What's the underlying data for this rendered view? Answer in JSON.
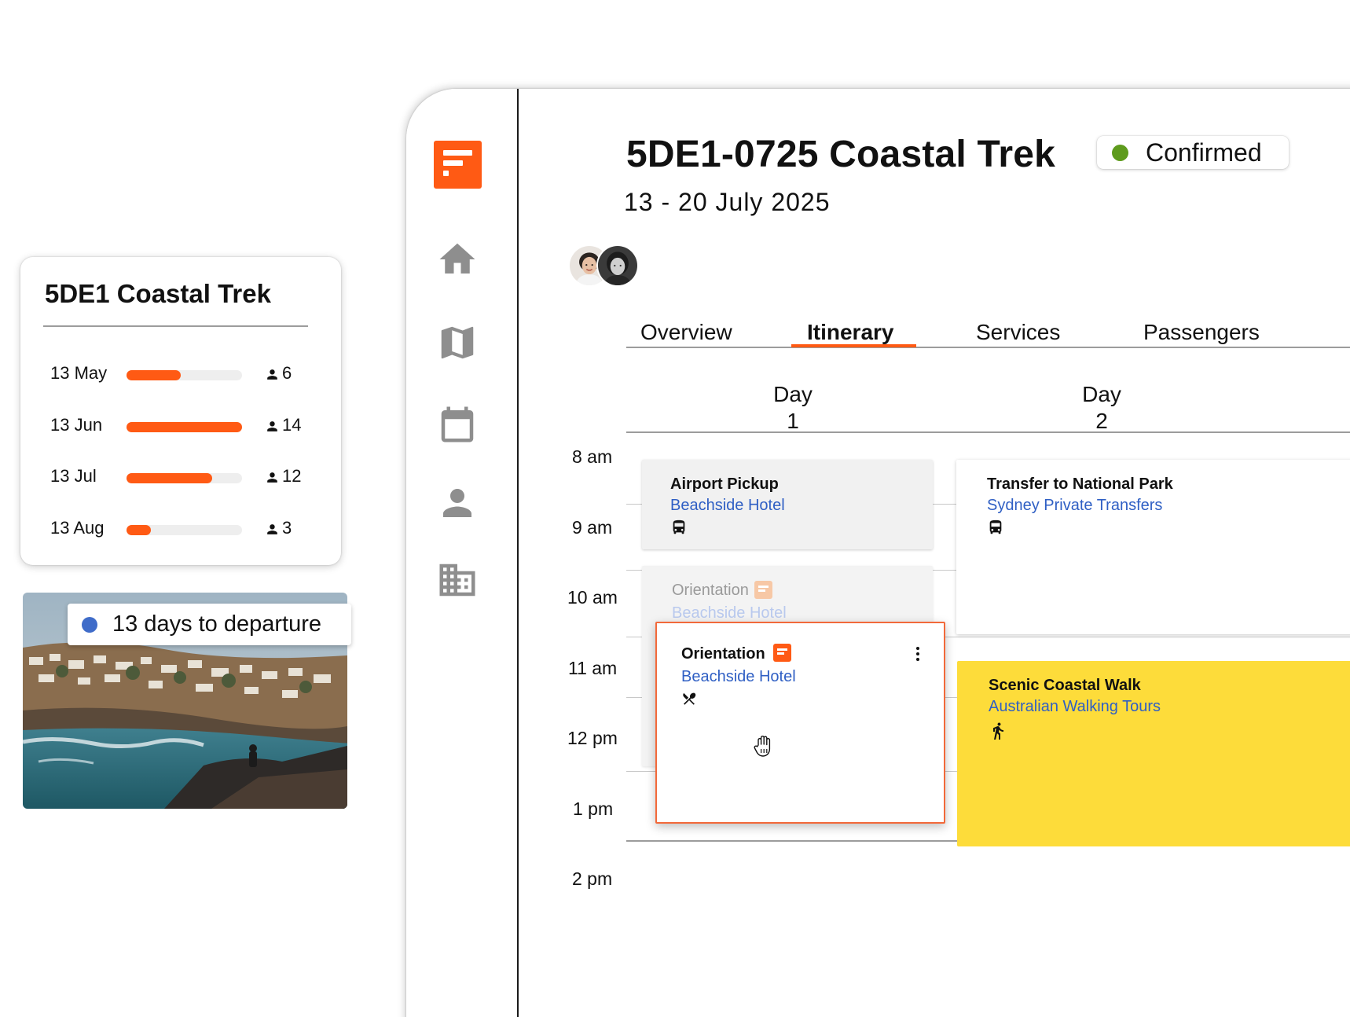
{
  "app": {
    "brand_color": "#ff5a14",
    "nav": [
      {
        "name": "home",
        "icon": "home-icon"
      },
      {
        "name": "map",
        "icon": "map-icon"
      },
      {
        "name": "calendar",
        "icon": "calendar-icon"
      },
      {
        "name": "person",
        "icon": "person-icon"
      },
      {
        "name": "building",
        "icon": "building-icon"
      }
    ]
  },
  "trip": {
    "title": "5DE1-0725 Coastal Trek",
    "status": "Confirmed",
    "status_color": "#5e9b1d",
    "dates": "13 - 20 July 2025"
  },
  "tabs": [
    {
      "label": "Overview",
      "active": false
    },
    {
      "label": "Itinerary",
      "active": true
    },
    {
      "label": "Services",
      "active": false
    },
    {
      "label": "Passengers",
      "active": false
    }
  ],
  "schedule": {
    "days": [
      {
        "label": "Day",
        "number": "1"
      },
      {
        "label": "Day",
        "number": "2"
      }
    ],
    "times": [
      "8 am",
      "9 am",
      "10 am",
      "11 am",
      "12 pm",
      "1 pm",
      "2 pm"
    ],
    "events": {
      "pickup": {
        "title": "Airport Pickup",
        "subtitle": "Beachside Hotel",
        "icon": "bus-icon"
      },
      "orientation_ghost": {
        "title": "Orientation",
        "subtitle": "Beachside Hotel",
        "icon": "note-icon"
      },
      "orientation": {
        "title": "Orientation",
        "subtitle": "Beachside Hotel",
        "icon": "note-icon",
        "icon2": "restaurant-icon"
      },
      "transfer": {
        "title": "Transfer to National Park",
        "subtitle": "Sydney Private Transfers",
        "icon": "bus-icon"
      },
      "walk": {
        "title": "Scenic Coastal Walk",
        "subtitle": "Australian Walking Tours",
        "icon": "walking-icon",
        "color": "#fddc3a"
      }
    }
  },
  "stats_card": {
    "title": "5DE1 Coastal Trek",
    "rows": [
      {
        "label": "13 May",
        "fill": 0.47,
        "count": "6"
      },
      {
        "label": "13 Jun",
        "fill": 1.0,
        "count": "14"
      },
      {
        "label": "13 Jul",
        "fill": 0.74,
        "count": "12"
      },
      {
        "label": "13 Aug",
        "fill": 0.21,
        "count": "3"
      }
    ]
  },
  "countdown": {
    "text": "13 days to departure",
    "dot_color": "#3f6cc9"
  }
}
